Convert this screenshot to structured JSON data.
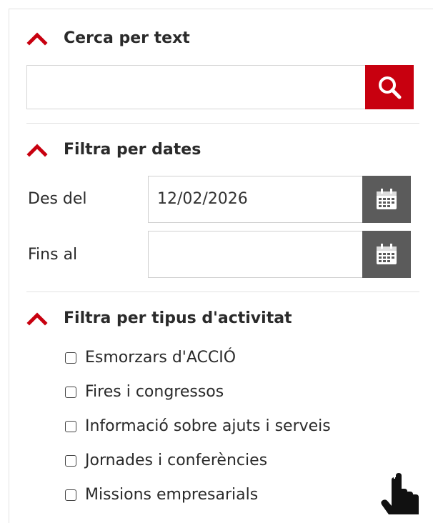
{
  "search": {
    "title": "Cerca per text",
    "placeholder": "",
    "value": "",
    "button_icon": "search-icon"
  },
  "dates": {
    "title": "Filtra per dates",
    "from_label": "Des del",
    "from_value": "12/02/2026",
    "to_label": "Fins al",
    "to_value": "",
    "calendar_icon": "calendar-icon"
  },
  "activity": {
    "title": "Filtra per tipus d'activitat",
    "options": [
      {
        "label": "Esmorzars d'ACCIÓ",
        "checked": false
      },
      {
        "label": "Fires i congressos",
        "checked": false
      },
      {
        "label": "Informació sobre ajuts i serveis",
        "checked": false
      },
      {
        "label": "Jornades i conferències",
        "checked": false
      },
      {
        "label": "Missions empresarials",
        "checked": false
      }
    ]
  },
  "colors": {
    "accent": "#c8000f",
    "calendar_button": "#5b5b5b",
    "border": "#d6d6d6"
  },
  "cursor_icon": "hand-pointer-icon"
}
